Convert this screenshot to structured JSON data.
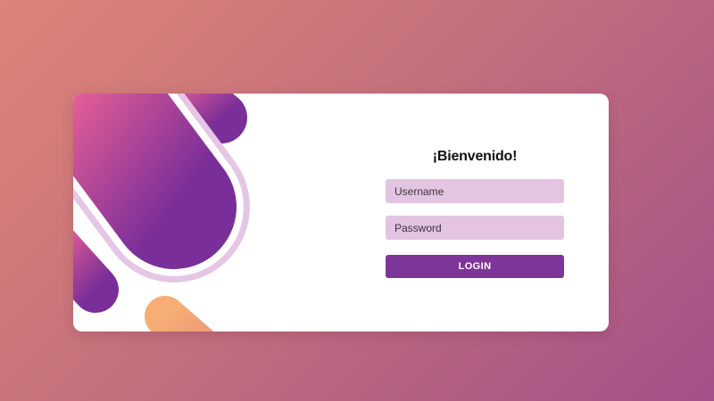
{
  "login_card": {
    "welcome_title": "¡Bienvenido!",
    "username_placeholder": "Username",
    "username_value": "",
    "password_placeholder": "Password",
    "password_value": "",
    "login_button_label": "LOGIN"
  },
  "decoration": {
    "shapes": [
      "pink-purple-pill",
      "lavender-outline-pill",
      "orange-pill"
    ]
  },
  "colors": {
    "background_start": "#DC8478",
    "background_end": "#A55089",
    "card": "#FFFFFF",
    "input_fill": "#E3C4E1",
    "button": "#7E359A",
    "pill_pink": "#E05C96",
    "pill_purple": "#7A2E99",
    "pill_orange": "#F3A574",
    "pill_outline": "#E5C6E5"
  }
}
